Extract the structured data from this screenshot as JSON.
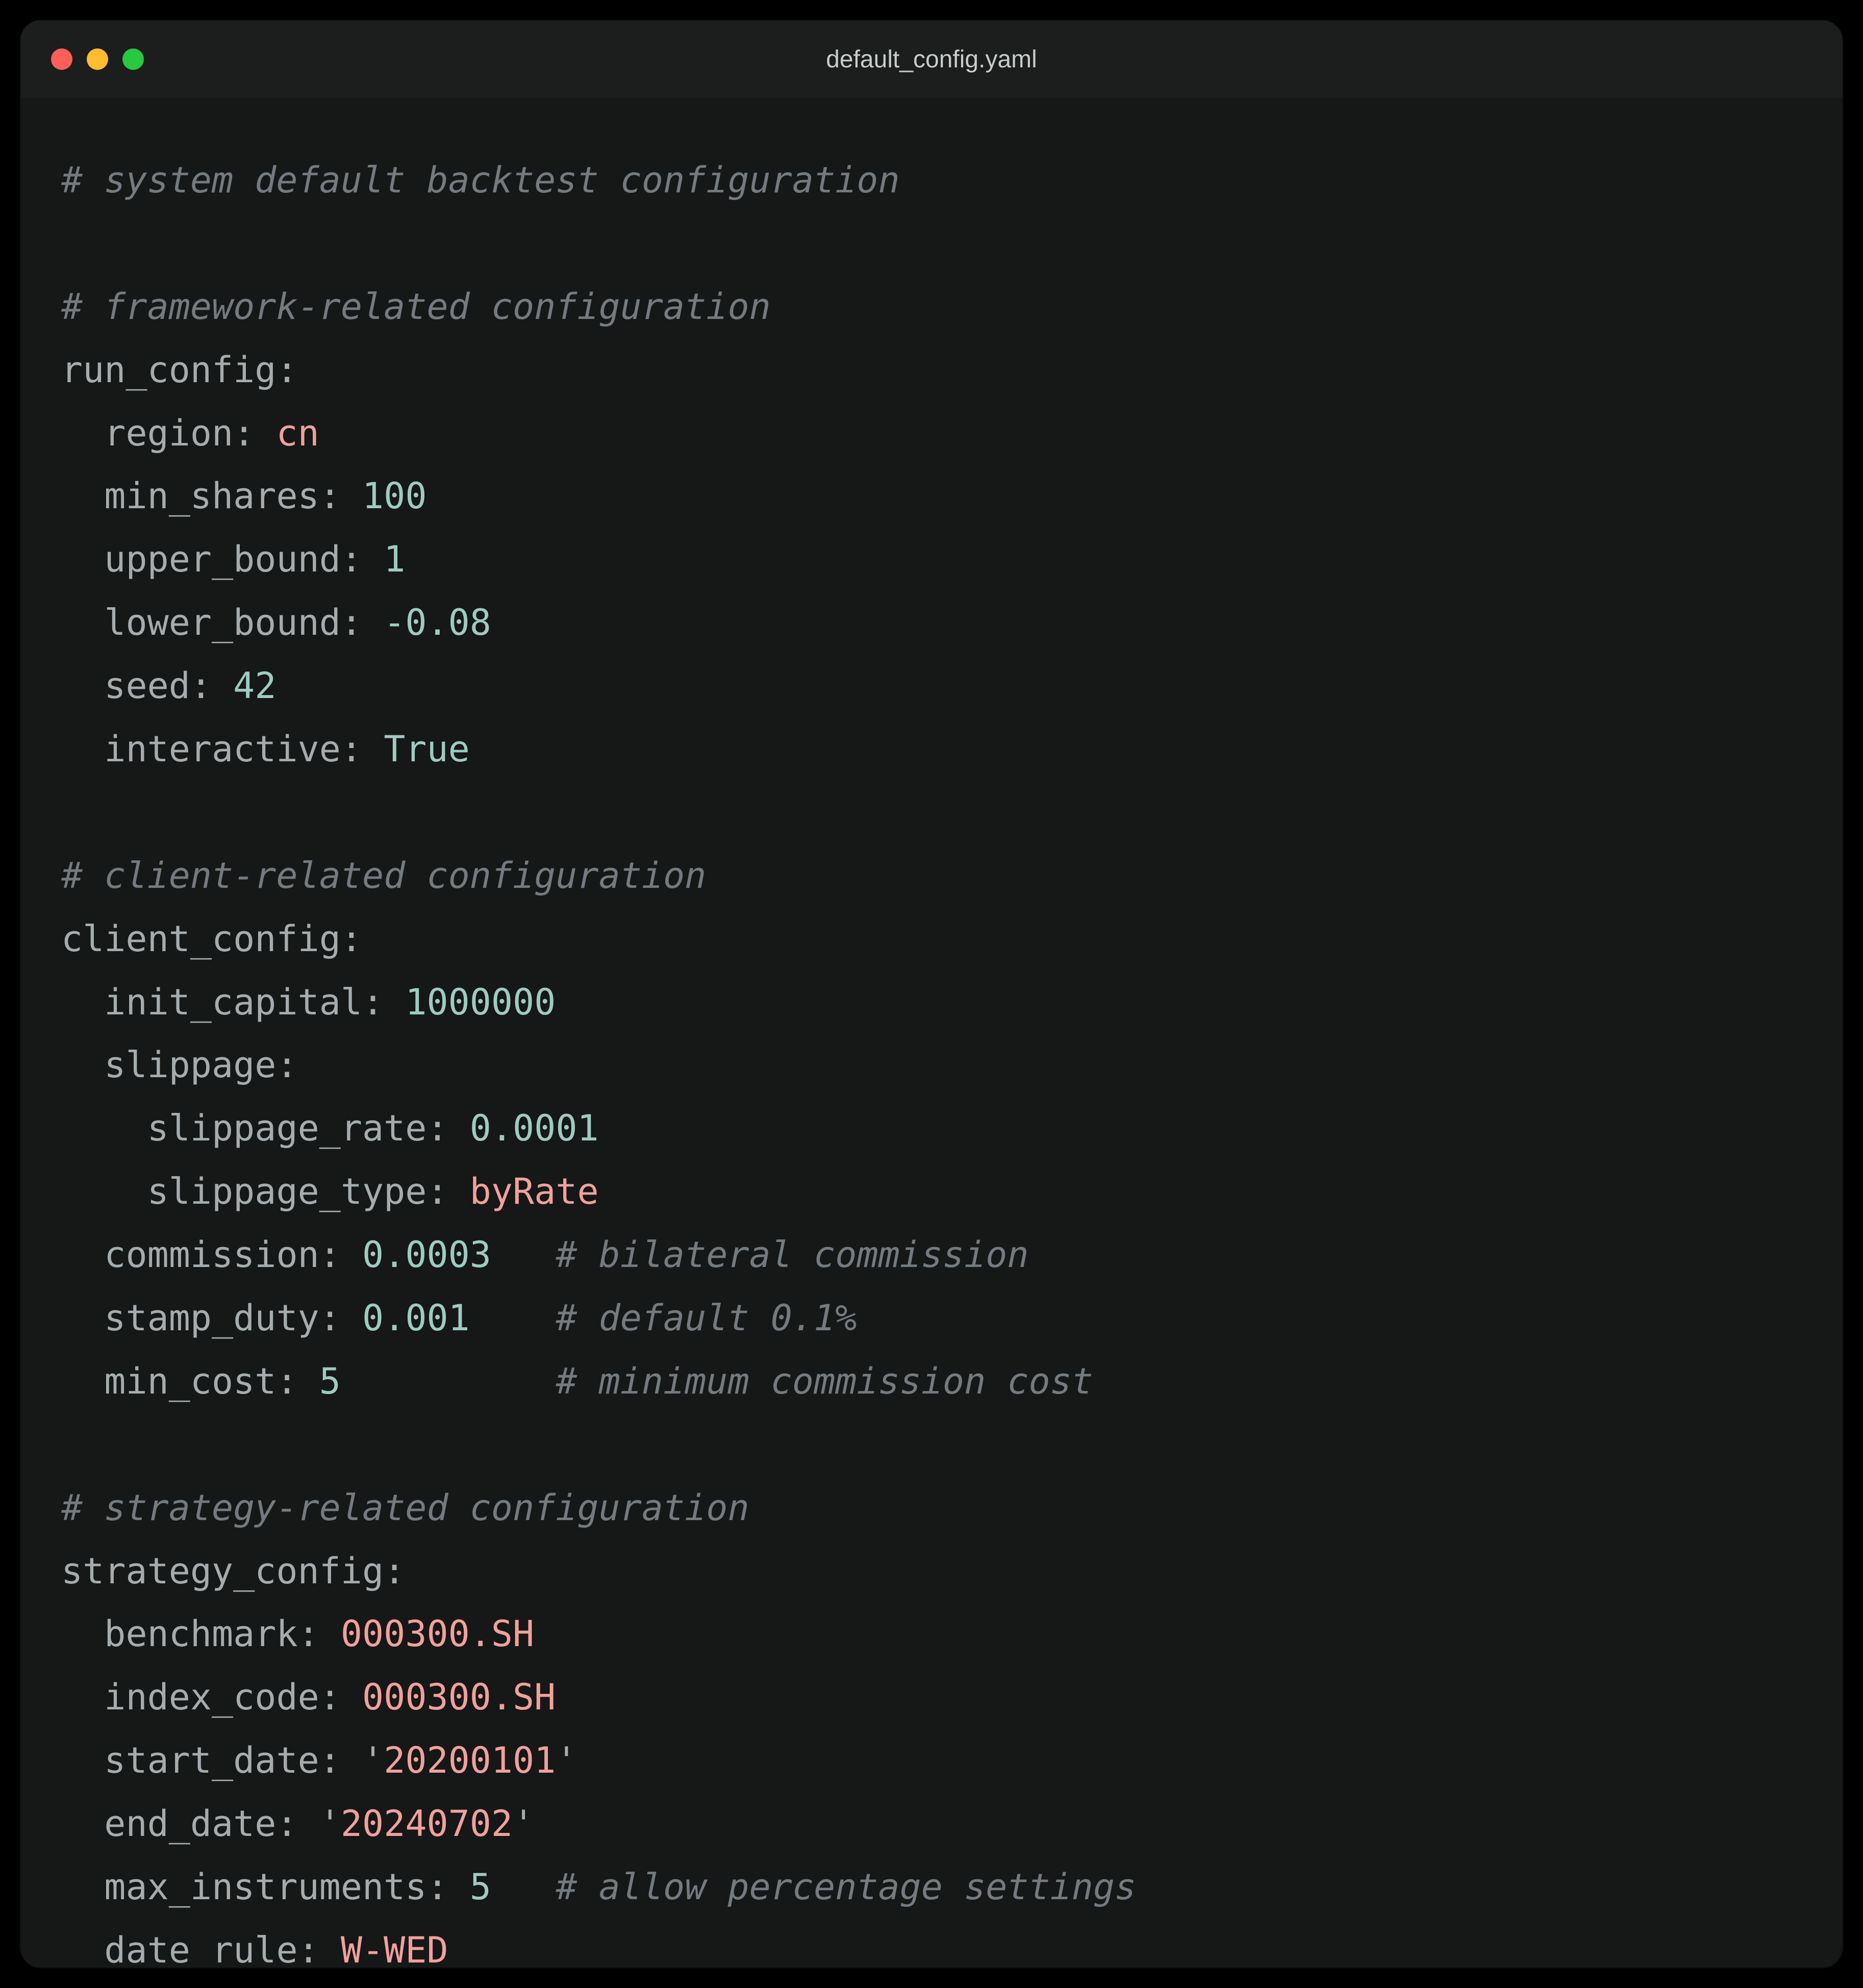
{
  "window": {
    "title": "default_config.yaml"
  },
  "colors": {
    "background": "#161717",
    "titlebar": "#1c1d1d",
    "comment": "#747a7e",
    "key": "#a6acad",
    "string": "#f0a19c",
    "number": "#9ecbc0"
  },
  "code_lines": [
    {
      "t": "comment",
      "text": "# system default backtest configuration"
    },
    {
      "t": "blank"
    },
    {
      "t": "comment",
      "text": "# framework-related configuration"
    },
    {
      "t": "key",
      "indent": 0,
      "key": "run_config"
    },
    {
      "t": "kv",
      "indent": 1,
      "key": "region",
      "val": "cn",
      "vt": "string"
    },
    {
      "t": "kv",
      "indent": 1,
      "key": "min_shares",
      "val": "100",
      "vt": "number"
    },
    {
      "t": "kv",
      "indent": 1,
      "key": "upper_bound",
      "val": "1",
      "vt": "number"
    },
    {
      "t": "kv",
      "indent": 1,
      "key": "lower_bound",
      "val": "-0.08",
      "vt": "number"
    },
    {
      "t": "kv",
      "indent": 1,
      "key": "seed",
      "val": "42",
      "vt": "number"
    },
    {
      "t": "kv",
      "indent": 1,
      "key": "interactive",
      "val": "True",
      "vt": "bool"
    },
    {
      "t": "blank"
    },
    {
      "t": "comment",
      "text": "# client-related configuration"
    },
    {
      "t": "key",
      "indent": 0,
      "key": "client_config"
    },
    {
      "t": "kv",
      "indent": 1,
      "key": "init_capital",
      "val": "1000000",
      "vt": "number"
    },
    {
      "t": "key",
      "indent": 1,
      "key": "slippage"
    },
    {
      "t": "kv",
      "indent": 2,
      "key": "slippage_rate",
      "val": "0.0001",
      "vt": "number"
    },
    {
      "t": "kv",
      "indent": 2,
      "key": "slippage_type",
      "val": "byRate",
      "vt": "string"
    },
    {
      "t": "kv",
      "indent": 1,
      "key": "commission",
      "val": "0.0003",
      "vt": "number",
      "pad": 3,
      "comment": "# bilateral commission"
    },
    {
      "t": "kv",
      "indent": 1,
      "key": "stamp_duty",
      "val": "0.001",
      "vt": "number",
      "pad": 4,
      "comment": "# default 0.1%"
    },
    {
      "t": "kv",
      "indent": 1,
      "key": "min_cost",
      "val": "5",
      "vt": "number",
      "pad": 10,
      "comment": "# minimum commission cost"
    },
    {
      "t": "blank"
    },
    {
      "t": "comment",
      "text": "# strategy-related configuration"
    },
    {
      "t": "key",
      "indent": 0,
      "key": "strategy_config"
    },
    {
      "t": "kv",
      "indent": 1,
      "key": "benchmark",
      "val": "000300.SH",
      "vt": "string"
    },
    {
      "t": "kv",
      "indent": 1,
      "key": "index_code",
      "val": "000300.SH",
      "vt": "string"
    },
    {
      "t": "kv",
      "indent": 1,
      "key": "start_date",
      "val": "20200101",
      "vt": "qstring"
    },
    {
      "t": "kv",
      "indent": 1,
      "key": "end_date",
      "val": "20240702",
      "vt": "qstring"
    },
    {
      "t": "kv",
      "indent": 1,
      "key": "max_instruments",
      "val": "5",
      "vt": "number",
      "pad": 3,
      "comment": "# allow percentage settings"
    },
    {
      "t": "kv",
      "indent": 1,
      "key": "date_rule",
      "val": "W-WED",
      "vt": "string"
    }
  ]
}
